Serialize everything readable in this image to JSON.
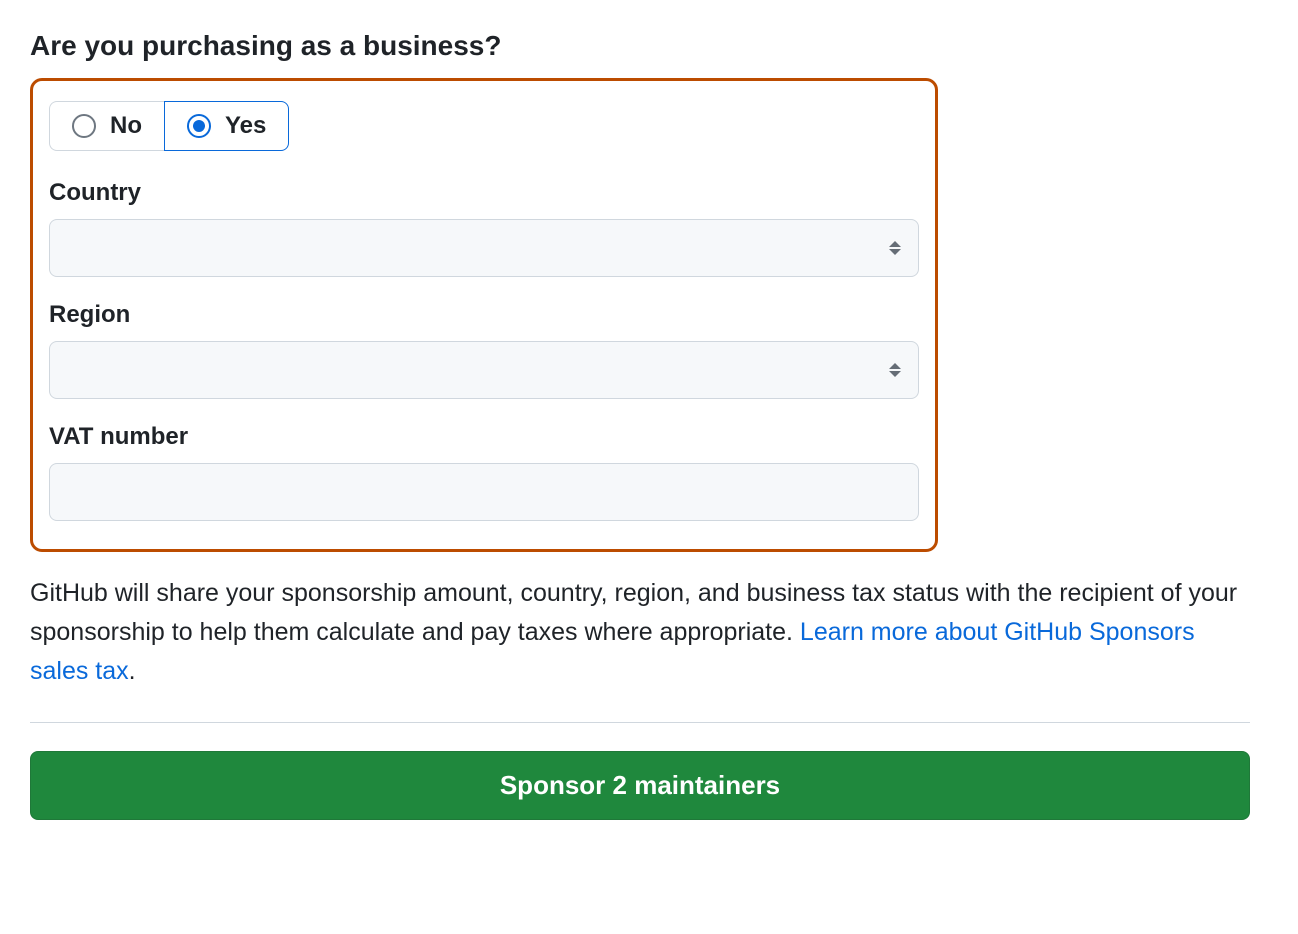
{
  "heading": "Are you purchasing as a business?",
  "business_toggle": {
    "no_label": "No",
    "yes_label": "Yes",
    "selected": "yes"
  },
  "form": {
    "country_label": "Country",
    "country_value": "",
    "region_label": "Region",
    "region_value": "",
    "vat_label": "VAT number",
    "vat_value": ""
  },
  "disclosure": {
    "text": "GitHub will share your sponsorship amount, country, region, and business tax status with the recipient of your sponsorship to help them calculate and pay taxes where appropriate. ",
    "link_text": "Learn more about GitHub Sponsors sales tax",
    "suffix": "."
  },
  "submit_button": "Sponsor 2 maintainers",
  "colors": {
    "highlight_border": "#bc4c00",
    "link": "#0969da",
    "primary_button": "#1f883d"
  }
}
